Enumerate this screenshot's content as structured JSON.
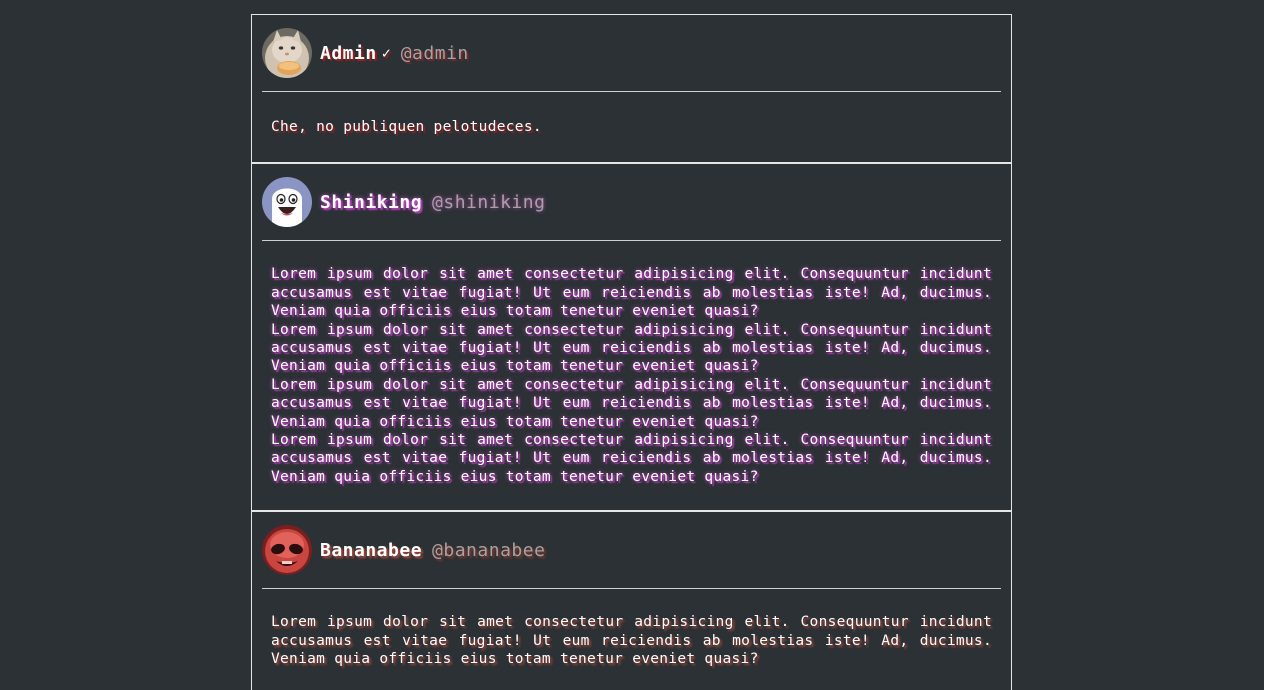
{
  "posts": [
    {
      "display_name": "Admin",
      "verified_mark": "✓",
      "handle": "@admin",
      "avatar": "cat-avatar",
      "paragraphs": [
        "Che, no publiquen pelotudeces."
      ]
    },
    {
      "display_name": "Shiniking",
      "handle": "@shiniking",
      "avatar": "ghost-avatar",
      "paragraphs": [
        "Lorem ipsum dolor sit amet consectetur adipisicing elit. Consequuntur incidunt accusamus est vitae fugiat! Ut eum reiciendis ab molestias iste! Ad, ducimus. Veniam quia officiis eius totam tenetur eveniet quasi?",
        "Lorem ipsum dolor sit amet consectetur adipisicing elit. Consequuntur incidunt accusamus est vitae fugiat! Ut eum reiciendis ab molestias iste! Ad, ducimus. Veniam quia officiis eius totam tenetur eveniet quasi?",
        "Lorem ipsum dolor sit amet consectetur adipisicing elit. Consequuntur incidunt accusamus est vitae fugiat! Ut eum reiciendis ab molestias iste! Ad, ducimus. Veniam quia officiis eius totam tenetur eveniet quasi?",
        "Lorem ipsum dolor sit amet consectetur adipisicing elit. Consequuntur incidunt accusamus est vitae fugiat! Ut eum reiciendis ab molestias iste! Ad, ducimus. Veniam quia officiis eius totam tenetur eveniet quasi?"
      ]
    },
    {
      "display_name": "Bananabee",
      "handle": "@bananabee",
      "avatar": "red-face-avatar",
      "paragraphs": [
        "Lorem ipsum dolor sit amet consectetur adipisicing elit. Consequuntur incidunt accusamus est vitae fugiat! Ut eum reiciendis ab molestias iste! Ad, ducimus. Veniam quia officiis eius totam tenetur eveniet quasi?"
      ]
    }
  ],
  "colors": {
    "background": "#2b3134",
    "border": "#e6e6e6",
    "text": "#ffffff",
    "handle": "#a9a2a2",
    "admin_shadow": "#9c1e1e",
    "shiniking_glow": "#d14bd6",
    "bananabee_shadow": "#b34a3c"
  }
}
